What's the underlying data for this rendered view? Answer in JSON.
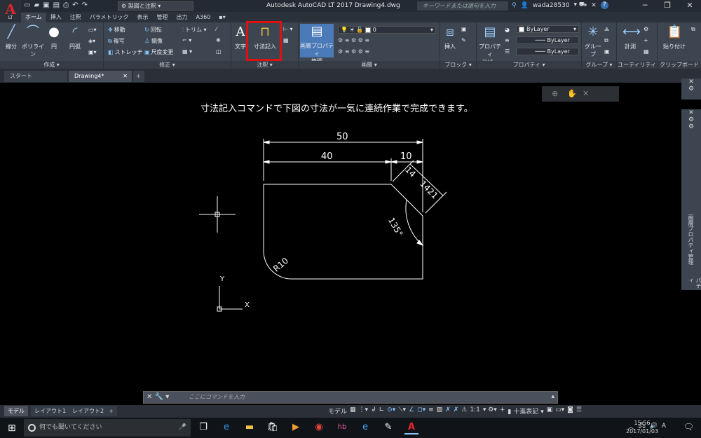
{
  "titlebar": {
    "logo_letter": "A",
    "logo_sub": "LT",
    "workspace": "製図と注釈",
    "title": "Autodesk AutoCAD LT 2017    Drawing4.dwg",
    "search_placeholder": "キーワードまたは語句を入力",
    "username": "wada28530",
    "help": "?"
  },
  "tabs": [
    "ホーム",
    "挿入",
    "注釈",
    "パラメトリック",
    "表示",
    "管理",
    "出力",
    "A360"
  ],
  "ribbon": {
    "draw": {
      "title": "作成",
      "line": "線分",
      "polyline": "ポリライン",
      "circle": "円",
      "arc": "円弧"
    },
    "modify": {
      "title": "修正",
      "move": "移動",
      "copy": "複写",
      "stretch": "ストレッチ",
      "rotate": "回転",
      "mirror": "鏡像",
      "scale": "尺度変更",
      "trim": "トリム"
    },
    "annotation": {
      "title": "注釈",
      "text": "文字",
      "dimension": "寸法記入"
    },
    "layers": {
      "title": "画層",
      "layer_props_1": "画層プロパティ",
      "layer_props_2": "管理",
      "current_layer": "0"
    },
    "block": {
      "title": "ブロック",
      "insert": "挿入"
    },
    "properties": {
      "title": "プロパティ",
      "match_1": "プロパティ",
      "match_2": "コピー",
      "color": "ByLayer",
      "linetype": "ByLayer",
      "lineweight": "ByLayer"
    },
    "groups": {
      "title": "グループ",
      "group": "グループ"
    },
    "utilities": {
      "title": "ユーティリティ",
      "measure": "計測"
    },
    "clipboard": {
      "title": "クリップボード",
      "paste": "貼り付け"
    }
  },
  "filetabs": {
    "start": "スタート",
    "drawing": "Drawing4*"
  },
  "canvas": {
    "instruction": "寸法記入コマンドで下図の寸法が一気に連続作業で完成できます。",
    "dim_overall": "50",
    "dim_left": "40",
    "dim_right": "10",
    "dim_chamfer_a": "14",
    "dim_chamfer_b": "1421",
    "dim_angle": "135°",
    "dim_radius": "R10",
    "ucs_x": "X",
    "ucs_y": "Y"
  },
  "rightpanel": {
    "label_1": "画層プロパティ管理",
    "label_2": "プロパティ"
  },
  "command": {
    "placeholder": "ここにコマンドを入力"
  },
  "layouttabs": [
    "モデル",
    "レイアウト1",
    "レイアウト2"
  ],
  "statusbar": {
    "model": "モデル",
    "scale": "1:1",
    "units": "十進表記"
  },
  "taskbar": {
    "search": "何でも聞いてください",
    "time": "15:56",
    "date": "2017/01/03",
    "ime": "A"
  }
}
